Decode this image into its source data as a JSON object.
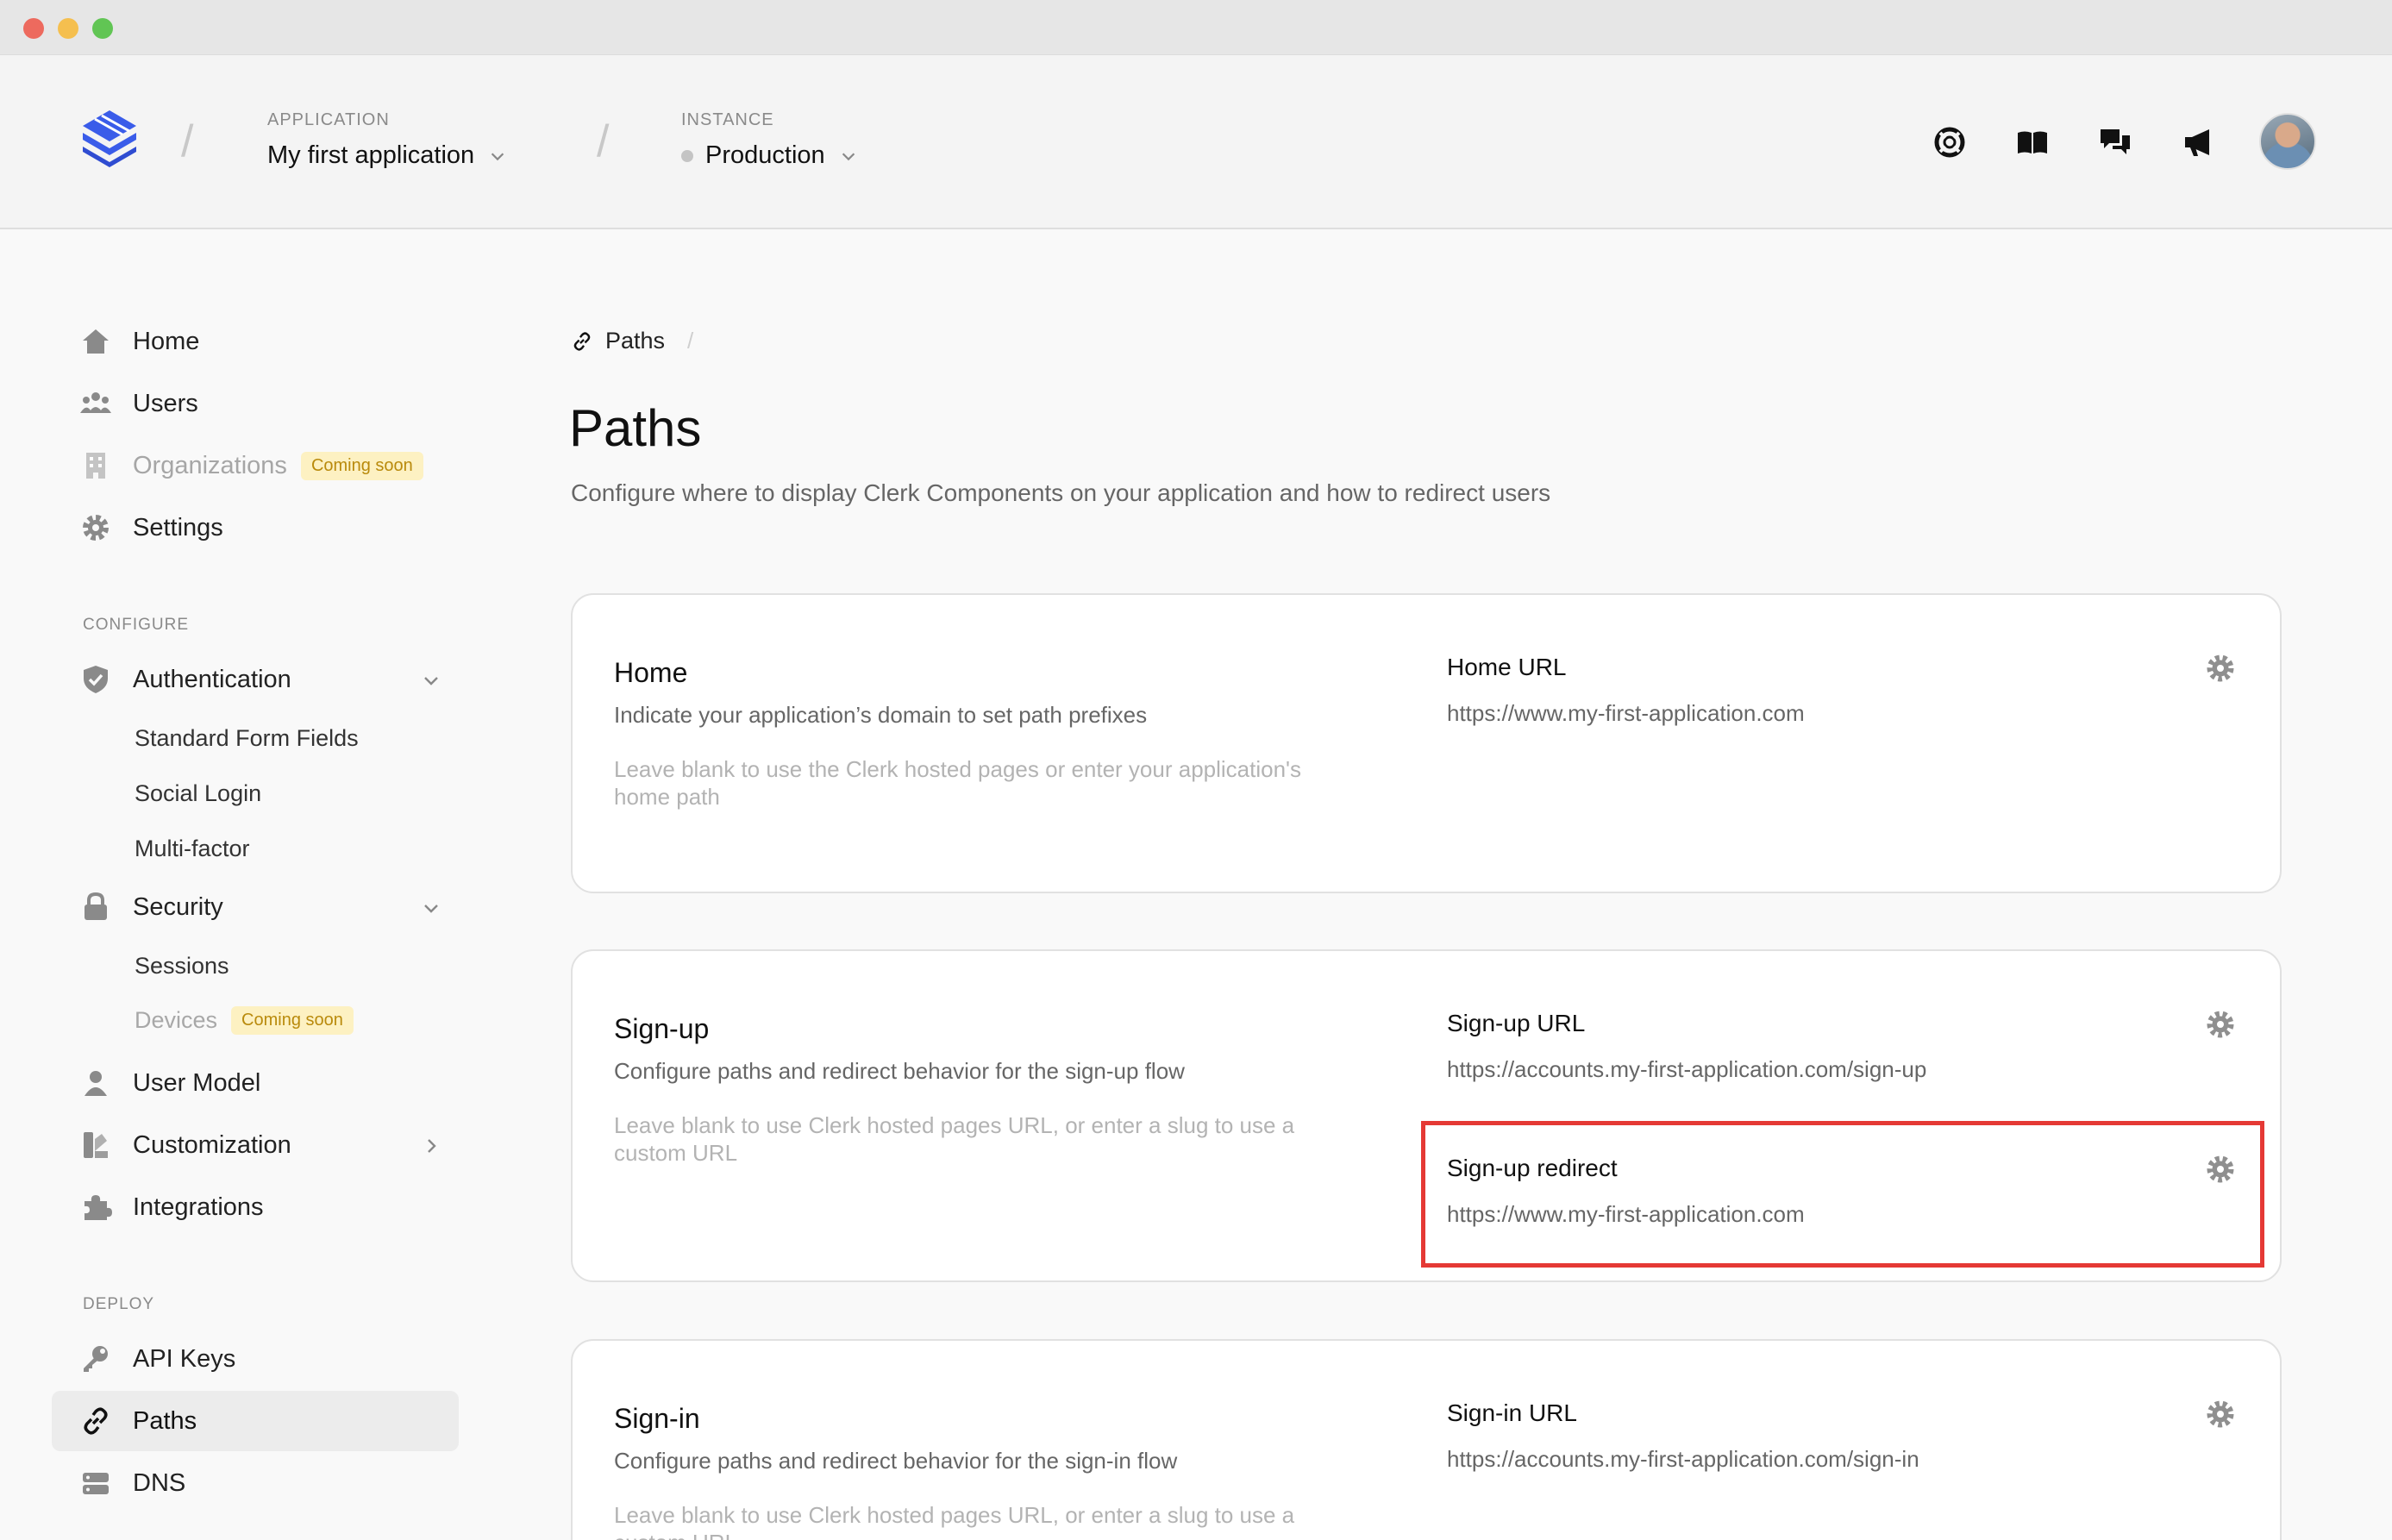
{
  "header": {
    "application_kicker": "APPLICATION",
    "application_name": "My first application",
    "instance_kicker": "INSTANCE",
    "instance_name": "Production"
  },
  "sidebar": {
    "items": [
      {
        "label": "Home",
        "icon": "home-icon"
      },
      {
        "label": "Users",
        "icon": "users-icon"
      },
      {
        "label": "Organizations",
        "icon": "building-icon",
        "badge": "Coming soon"
      },
      {
        "label": "Settings",
        "icon": "gear-icon"
      }
    ],
    "configure_label": "CONFIGURE",
    "authentication": {
      "label": "Authentication",
      "sub": [
        "Standard Form Fields",
        "Social Login",
        "Multi-factor"
      ]
    },
    "security": {
      "label": "Security",
      "sub_sessions": "Sessions",
      "sub_devices": "Devices",
      "devices_badge": "Coming soon"
    },
    "user_model": "User Model",
    "customization": "Customization",
    "integrations": "Integrations",
    "deploy_label": "DEPLOY",
    "api_keys": "API Keys",
    "paths": "Paths",
    "dns": "DNS"
  },
  "main": {
    "breadcrumb": "Paths",
    "breadcrumb_sep": "/",
    "title": "Paths",
    "description": "Configure where to display Clerk Components on your application and how to redirect users",
    "cards": [
      {
        "title": "Home",
        "description": "Indicate your application’s domain to set path prefixes",
        "hint": "Leave blank to use the Clerk hosted pages or enter your application's home path",
        "fields": [
          {
            "label": "Home URL",
            "value": "https://www.my-first-application.com"
          }
        ]
      },
      {
        "title": "Sign-up",
        "description": "Configure paths and redirect behavior for the sign-up flow",
        "hint": "Leave blank to use Clerk hosted pages URL, or enter a slug to use a custom URL",
        "fields": [
          {
            "label": "Sign-up URL",
            "value": "https://accounts.my-first-application.com/sign-up"
          },
          {
            "label": "Sign-up redirect",
            "value": "https://www.my-first-application.com"
          }
        ]
      },
      {
        "title": "Sign-in",
        "description": "Configure paths and redirect behavior for the sign-in flow",
        "hint": "Leave blank to use Clerk hosted pages URL, or enter a slug to use a custom URL",
        "fields": [
          {
            "label": "Sign-in URL",
            "value": "https://accounts.my-first-application.com/sign-in"
          }
        ]
      }
    ]
  },
  "colors": {
    "accent": "#3a5ce9",
    "highlight": "#e53935",
    "badge_bg": "#fdf1c2",
    "badge_text": "#b98a0c"
  }
}
